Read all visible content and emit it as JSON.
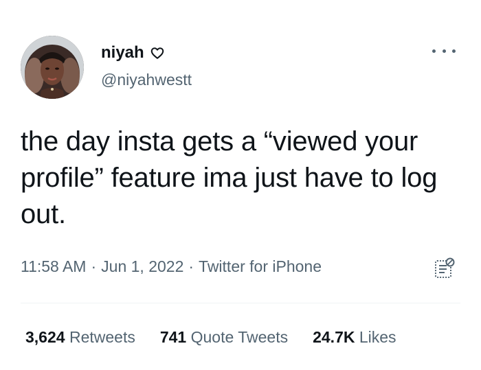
{
  "tweet": {
    "author": {
      "display_name": "niyah",
      "handle": "@niyahwestt",
      "name_badge_icon": "heart-outline-icon"
    },
    "text": "the day insta gets a “viewed your profile” feature ima just have to log out.",
    "time": "11:58 AM",
    "date": "Jun 1, 2022",
    "source": "Twitter for iPhone",
    "separator": "·",
    "stats": {
      "retweets_count": "3,624",
      "retweets_label": "Retweets",
      "quote_tweets_count": "741",
      "quote_tweets_label": "Quote Tweets",
      "likes_count": "24.7K",
      "likes_label": "Likes"
    }
  },
  "icons": {
    "more": "more-options-icon",
    "analytics": "analytics-icon"
  },
  "colors": {
    "text_primary": "#0f1419",
    "text_secondary": "#536471",
    "divider": "#eff3f4"
  }
}
